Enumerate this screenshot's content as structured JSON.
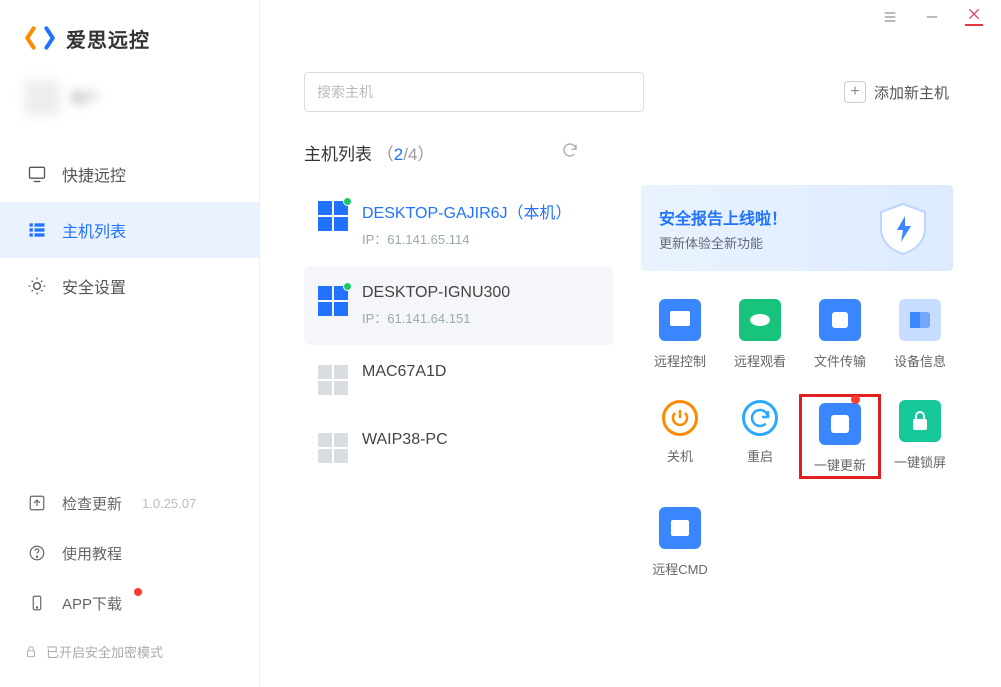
{
  "app": {
    "name": "爱思远控"
  },
  "titlebar": {
    "menu": "menu",
    "min": "minimize",
    "close": "close"
  },
  "user": {
    "name": "用户"
  },
  "sidebar": {
    "items": [
      {
        "label": "快捷远控",
        "icon": "monitor"
      },
      {
        "label": "主机列表",
        "icon": "list"
      },
      {
        "label": "安全设置",
        "icon": "shield-gear"
      }
    ],
    "bottom": [
      {
        "label": "检查更新",
        "icon": "upload",
        "version": "1.0.25.07"
      },
      {
        "label": "使用教程",
        "icon": "help"
      },
      {
        "label": "APP下载",
        "icon": "phone",
        "dot": true
      }
    ],
    "secure_mode": "已开启安全加密模式"
  },
  "toolbar": {
    "search_placeholder": "搜索主机",
    "add_host": "添加新主机"
  },
  "list": {
    "title": "主机列表",
    "online": "2",
    "total": "4"
  },
  "hosts": [
    {
      "name": "DESKTOP-GAJIR6J（本机）",
      "ip": "IP：61.141.65.114",
      "online": true,
      "blue": true
    },
    {
      "name": "DESKTOP-IGNU300",
      "ip": "IP：61.141.64.151",
      "online": true,
      "selected": true
    },
    {
      "name": "MAC67A1D",
      "ip": "",
      "online": false
    },
    {
      "name": "WAIP38-PC",
      "ip": "",
      "online": false
    }
  ],
  "banner": {
    "title": "安全报告上线啦！",
    "sub": "更新体验全新功能"
  },
  "actions": [
    {
      "label": "远程控制",
      "icon": "screen-arrow",
      "style": "c-blue"
    },
    {
      "label": "远程观看",
      "icon": "eye",
      "style": "c-green"
    },
    {
      "label": "文件传输",
      "icon": "transfer",
      "style": "c-blue2"
    },
    {
      "label": "设备信息",
      "icon": "info-card",
      "style": "c-lblue"
    },
    {
      "label": "关机",
      "icon": "power",
      "style": "c-orange",
      "ring": true
    },
    {
      "label": "重启",
      "icon": "restart",
      "style": "c-cyan",
      "ring": true
    },
    {
      "label": "一键更新",
      "icon": "update",
      "style": "c-blue",
      "highlight": true,
      "dot": true
    },
    {
      "label": "一键锁屏",
      "icon": "lock",
      "style": "c-teal"
    },
    {
      "label": "远程CMD",
      "icon": "terminal",
      "style": "c-blue"
    }
  ]
}
